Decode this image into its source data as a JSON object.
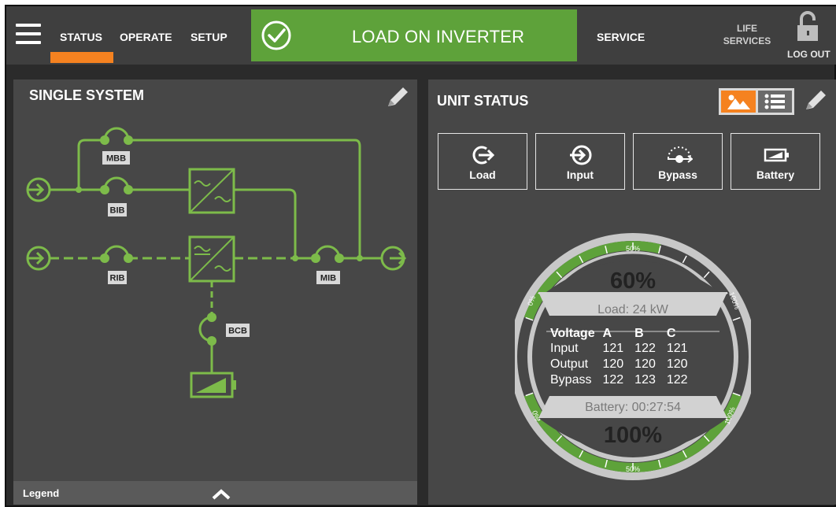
{
  "nav": {
    "status": "STATUS",
    "operate": "OPERATE",
    "setup": "SETUP",
    "service": "SERVICE",
    "life_services_line1": "LIFE",
    "life_services_line2": "SERVICES",
    "logout": "LOG OUT"
  },
  "banner": {
    "text": "LOAD ON INVERTER"
  },
  "left_panel": {
    "title": "SINGLE SYSTEM",
    "legend": "Legend",
    "labels": {
      "mbb": "MBB",
      "bib": "BIB",
      "rib": "RIB",
      "mib": "MIB",
      "bcb": "BCB"
    }
  },
  "right_panel": {
    "title": "UNIT STATUS",
    "tiles": [
      {
        "label": "Load",
        "icon": "load-icon"
      },
      {
        "label": "Input",
        "icon": "input-icon"
      },
      {
        "label": "Bypass",
        "icon": "bypass-icon"
      },
      {
        "label": "Battery",
        "icon": "battery-icon"
      }
    ],
    "gauge": {
      "load_percent": "60%",
      "load_kw": "Load: 24 kW",
      "battery_time": "Battery: 00:27:54",
      "battery_percent": "100%",
      "load_fraction": 0.6,
      "battery_fraction": 1.0,
      "tick_top_left": "0%",
      "tick_top_mid": "50%",
      "tick_top_right": "100%",
      "tick_bot_left": "0%",
      "tick_bot_mid": "50%",
      "tick_bot_right": "100%"
    },
    "voltage_table": {
      "headers": [
        "Voltage",
        "A",
        "B",
        "C"
      ],
      "rows": [
        [
          "Input",
          "121",
          "122",
          "121"
        ],
        [
          "Output",
          "120",
          "120",
          "120"
        ],
        [
          "Bypass",
          "122",
          "123",
          "122"
        ]
      ]
    }
  },
  "colors": {
    "accent_green": "#5ea23a",
    "line_green": "#7dbb4a",
    "orange": "#f58220",
    "panel": "#474747"
  }
}
